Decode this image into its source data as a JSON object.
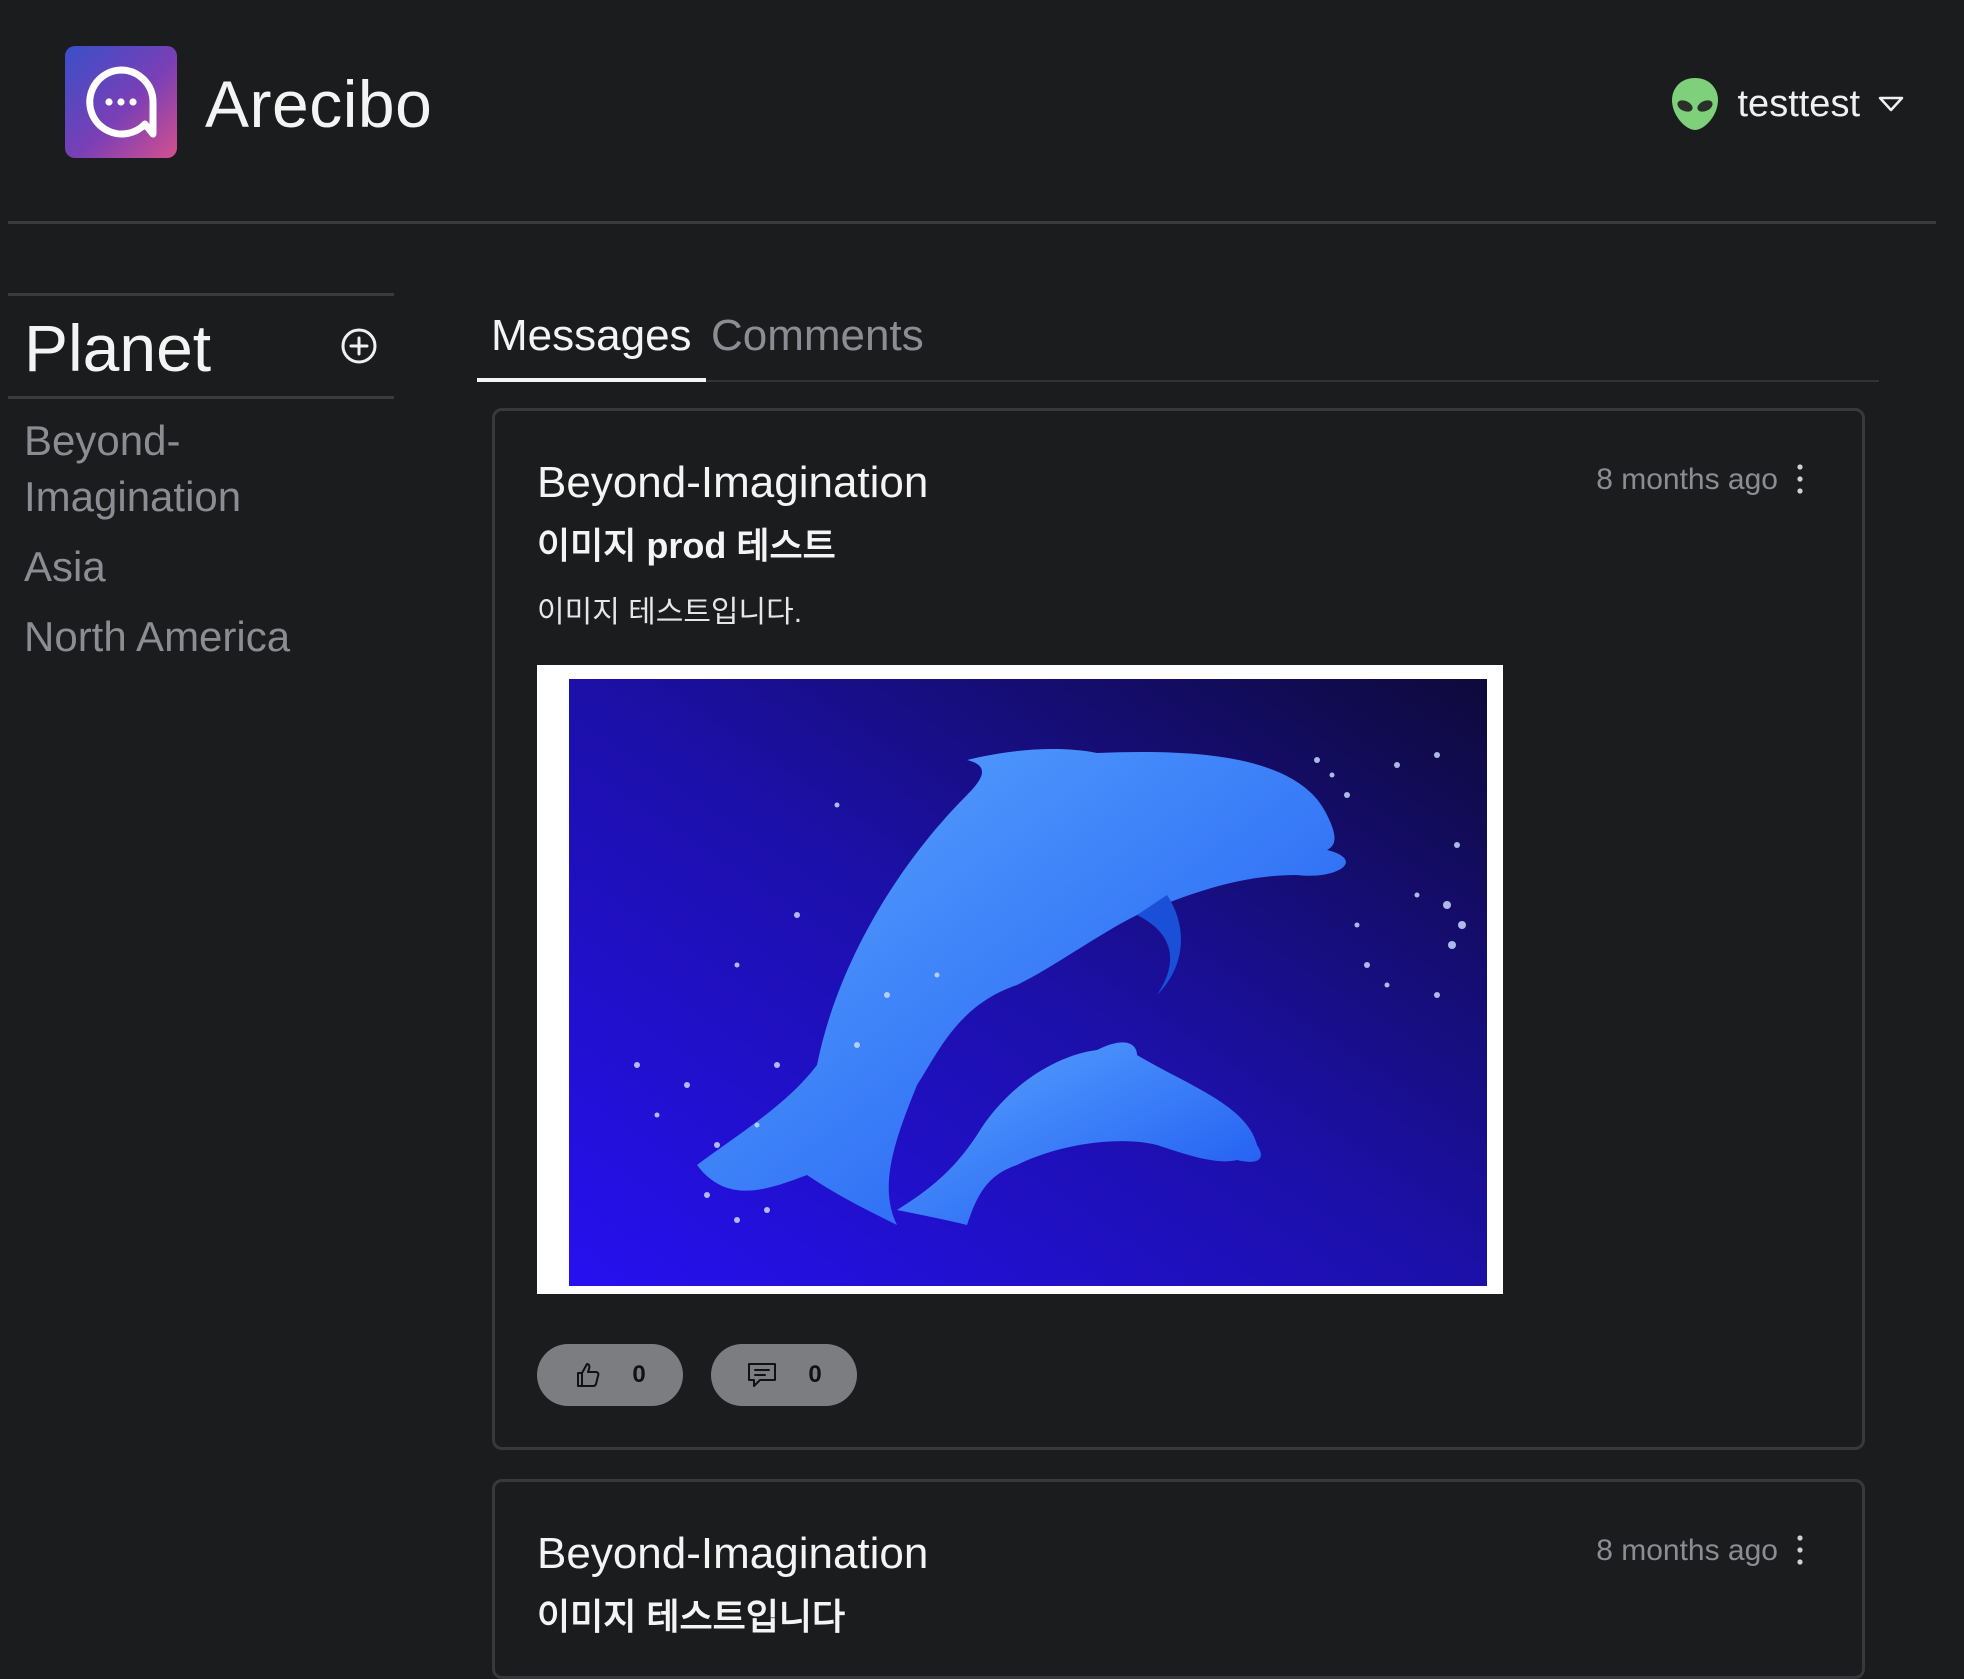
{
  "app": {
    "title": "Arecibo"
  },
  "user": {
    "name": "testtest",
    "avatar_icon": "alien-icon"
  },
  "sidebar": {
    "title": "Planet",
    "items": [
      {
        "label": "Beyond-Imagination"
      },
      {
        "label": "Asia"
      },
      {
        "label": "North America"
      }
    ]
  },
  "tabs": [
    {
      "label": "Messages",
      "active": true
    },
    {
      "label": "Comments",
      "active": false
    }
  ],
  "posts": [
    {
      "planet": "Beyond-Imagination",
      "time": "8 months ago",
      "title": "이미지 prod 테스트",
      "body": "이미지 테스트입니다.",
      "image_subject": "two blue dolphins leaping",
      "likes": "0",
      "comments": "0"
    },
    {
      "planet": "Beyond-Imagination",
      "time": "8 months ago",
      "title": "이미지 테스트입니다"
    }
  ],
  "colors": {
    "background": "#1b1c1e",
    "muted_text": "#8c8d92",
    "pill": "#7c7d80",
    "logo_gradient": [
      "#3a4fc8",
      "#7a3fb6",
      "#d4508e"
    ],
    "avatar": "#7ed07a"
  }
}
